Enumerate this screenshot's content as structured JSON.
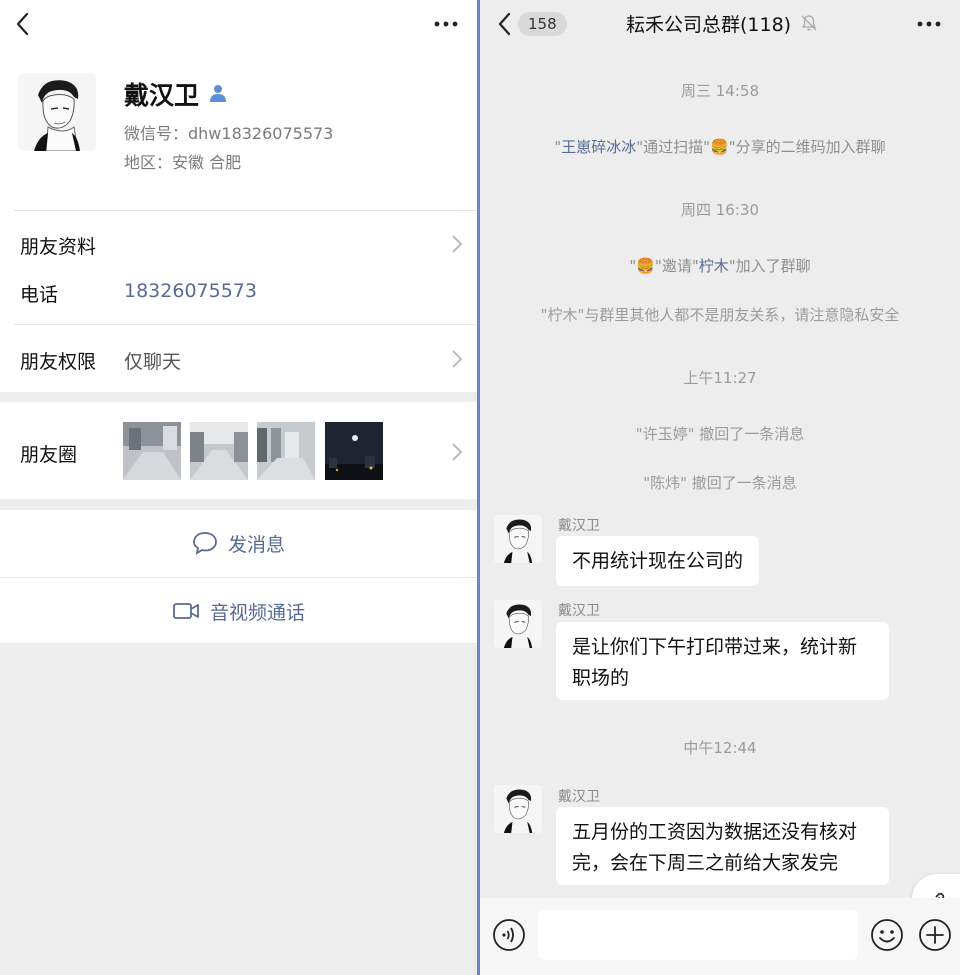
{
  "contact": {
    "name": "戴汉卫",
    "wechat_id": "微信号：dhw18326075573",
    "region": "地区：安徽  合肥",
    "friend_info_label": "朋友资料",
    "phone_label": "电话",
    "phone_value": "18326075573",
    "permission_label": "朋友权限",
    "permission_value": "仅聊天",
    "moments_label": "朋友圈",
    "send_message": "发消息",
    "av_call": "音视频通话"
  },
  "chat": {
    "unread_count": "158",
    "title": "耘禾公司总群(118)",
    "events": {
      "t1": "周三 14:58",
      "join_a_name": "王崽碎冰冰",
      "join_a_text1": "\"",
      "join_a_text2": "\"通过扫描\"",
      "join_a_text3": "\"分享的二维码加入群聊",
      "t2": "周四 16:30",
      "invite_pre": "\"",
      "invite_mid": "\"邀请\"",
      "invite_name": "柠木",
      "invite_post": "\"加入了群聊",
      "privacy": "\"柠木\"与群里其他人都不是朋友关系，请注意隐私安全",
      "t3": "上午11:27",
      "recall1": "\"许玉婷\" 撤回了一条消息",
      "recall2": "\"陈炜\" 撤回了一条消息",
      "t4": "中午12:44"
    },
    "messages": [
      {
        "sender": "戴汉卫",
        "text": "不用统计现在公司的"
      },
      {
        "sender": "戴汉卫",
        "text_line1": "是让你们下午打印带过来，统计新",
        "text_line2": "职场的"
      },
      {
        "sender": "戴汉卫",
        "text_line1": "五月份的工资因为数据还没有核对",
        "text_line2": "完，会在下周三之前给大家发完"
      }
    ]
  },
  "colors": {
    "link_blue": "#576b95",
    "panel_bg": "#ededed",
    "split_line": "#6b84c8"
  }
}
